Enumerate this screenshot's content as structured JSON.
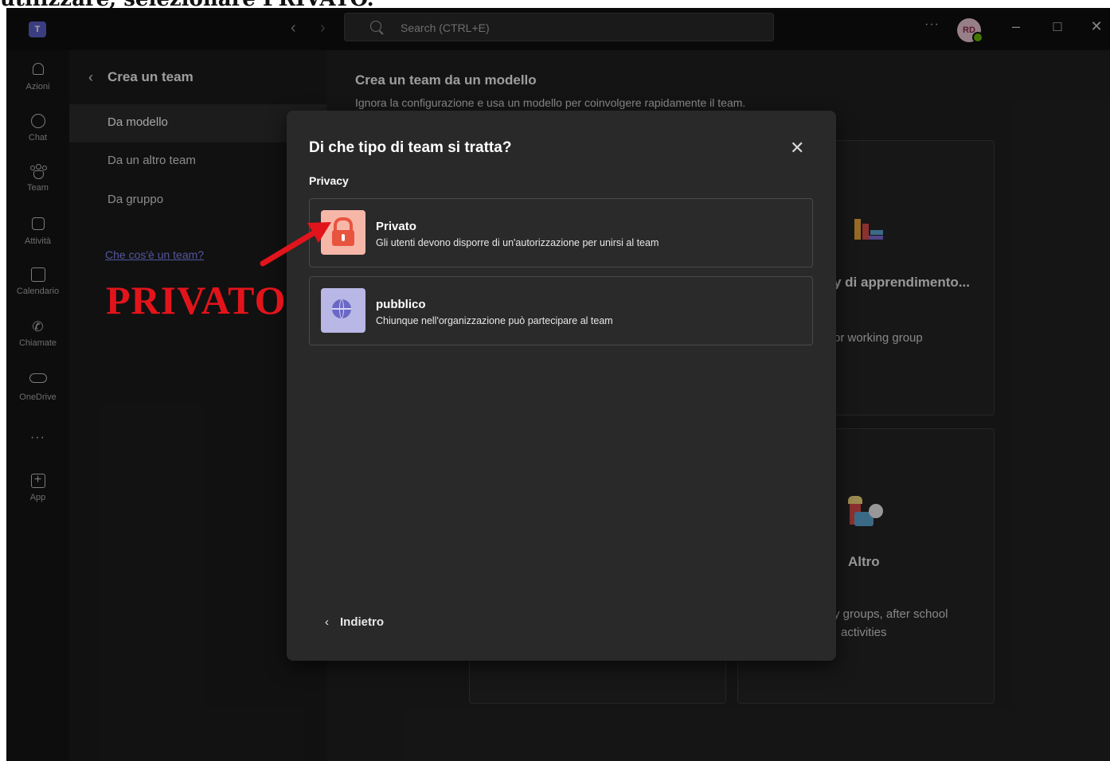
{
  "caption": "utilizzare, selezionare PRIVATO.",
  "titlebar": {
    "logo_text": "T",
    "back_arrow": "‹",
    "forward_arrow": "›",
    "search_placeholder": "Search (CTRL+E)",
    "more": "···",
    "avatar_initials": "RD",
    "minimize": "–",
    "maximize": "□",
    "close": "✕"
  },
  "rail": {
    "items": [
      {
        "label": "Azioni",
        "icon": "bell-icon"
      },
      {
        "label": "Chat",
        "icon": "chat-icon"
      },
      {
        "label": "Team",
        "icon": "teams-icon"
      },
      {
        "label": "Attività",
        "icon": "activity-icon"
      },
      {
        "label": "Calendario",
        "icon": "calendar-icon"
      },
      {
        "label": "Chiamate",
        "icon": "phone-icon"
      },
      {
        "label": "OneDrive",
        "icon": "cloud-icon"
      },
      {
        "label": "App",
        "icon": "apps-icon"
      }
    ],
    "more": "···"
  },
  "leftpanel": {
    "back": "‹",
    "title": "Crea un team",
    "items": [
      "Da modello",
      "Da un altro team",
      "Da gruppo"
    ],
    "link": "Che cos'è un team?"
  },
  "annotation": {
    "label": "PRIVATO",
    "arrow_color": "#e2141b"
  },
  "main": {
    "title": "Crea un team da un modello",
    "subtitle": "Ignora la configurazione e usa un modello per coinvolgere rapidamente il team.",
    "cards": [
      {
        "title": "y di apprendimento...",
        "desc": "or working group"
      },
      {
        "title": "Altro",
        "desc_line1": "y groups, after school",
        "desc_line2": "activities"
      }
    ]
  },
  "dialog": {
    "title": "Di che tipo di team si tratta?",
    "close": "✕",
    "section": "Privacy",
    "options": [
      {
        "title": "Privato",
        "desc": "Gli utenti devono disporre di un'autorizzazione per unirsi al team",
        "icon": "lock-icon",
        "icon_bg": "#f7b7a8",
        "icon_color": "#e8543e"
      },
      {
        "title": "pubblico",
        "desc": "Chiunque nell'organizzazione può partecipare al team",
        "icon": "globe-icon",
        "icon_bg": "#b9b7e5",
        "icon_color": "#6a67c7"
      }
    ],
    "back_chevron": "‹",
    "back": "Indietro"
  }
}
